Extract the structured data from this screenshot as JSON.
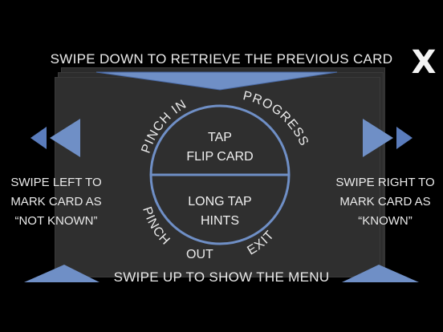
{
  "instructions": {
    "top": "SWIPE DOWN TO RETRIEVE THE PREVIOUS CARD",
    "bottom": "SWIPE UP TO SHOW THE MENU",
    "left": [
      "SWIPE LEFT TO",
      "MARK CARD AS",
      "“NOT KNOWN”"
    ],
    "right": [
      "SWIPE RIGHT TO",
      "MARK CARD AS",
      "“KNOWN”"
    ]
  },
  "close": {
    "label": "X"
  },
  "dial": {
    "tap_line1": "TAP",
    "tap_line2": "FLIP CARD",
    "long_tap_line1": "LONG TAP",
    "long_tap_line2": "HINTS",
    "pinch_in": "PINCH IN",
    "progress": "PROGRESS",
    "pinch_out_1": "PINCH",
    "pinch_out_2": "OUT",
    "exit": "EXIT"
  },
  "colors": {
    "accent": "#6f8fc6",
    "accent_dark": "#3f5f9a",
    "card": "#2b2b2b",
    "text": "#eaeaea"
  }
}
